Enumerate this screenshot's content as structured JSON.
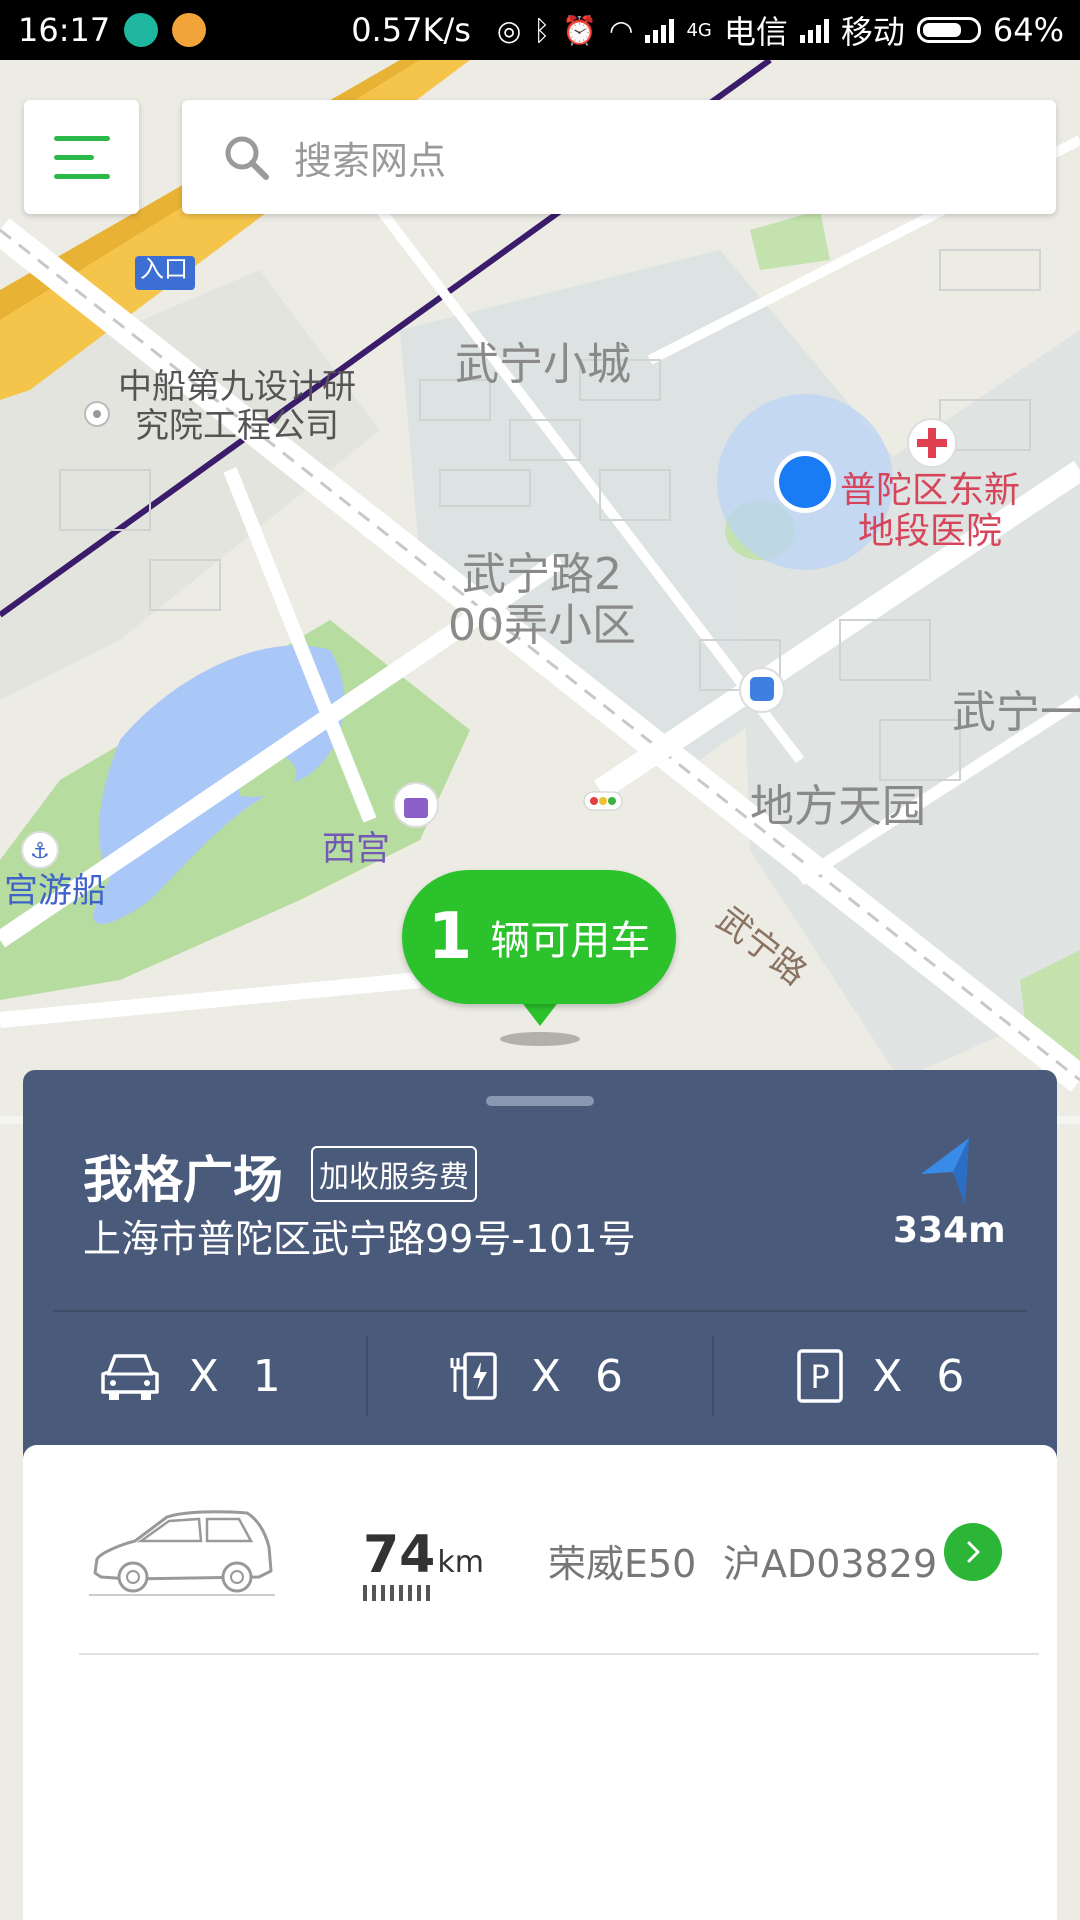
{
  "status_bar": {
    "time": "16:17",
    "net_speed": "0.57K/s",
    "carrier_1": "电信",
    "carrier_2": "移动",
    "battery": "64%",
    "network_type": "4G"
  },
  "search": {
    "placeholder": "搜索网点"
  },
  "map": {
    "labels": {
      "entrance": "入口",
      "company": "中船第九设计研\n究院工程公司",
      "wuning_xiaocheng": "武宁小城",
      "hospital": "普陀区东新\n地段医院",
      "wuning_200": "武宁路2\n00弄小区",
      "wuning_1": "武宁一",
      "difang_tianyuan": "地方天园",
      "xigong": "西宫",
      "gong_youchuan": "宫游船",
      "wuning_road": "武宁路"
    },
    "available_pin": {
      "count": "1",
      "label": "辆可用车"
    }
  },
  "station": {
    "name": "我格广场",
    "fee_badge": "加收服务费",
    "address": "上海市普陀区武宁路99号-101号",
    "distance": "334m",
    "stats": {
      "cars": "X 1",
      "chargers": "X 6",
      "parking": "X 6"
    }
  },
  "car": {
    "range_value": "74",
    "range_unit": "km",
    "model": "荣威E50",
    "plate": "沪AD03829"
  },
  "colors": {
    "accent_green": "#2cc22c",
    "panel_blue": "#4a5a7a",
    "location_blue": "#1a7cf5"
  }
}
